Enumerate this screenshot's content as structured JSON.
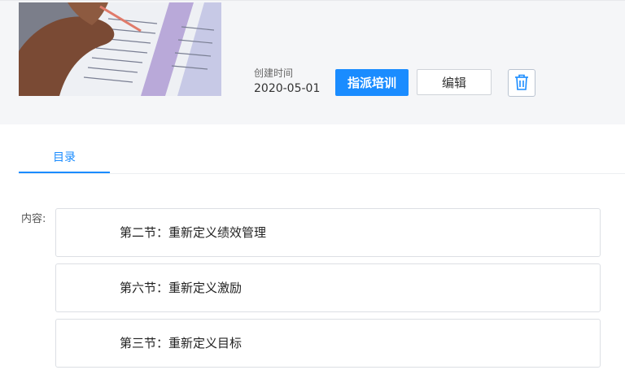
{
  "course": {
    "created_label": "创建时间",
    "created_date": "2020-05-01"
  },
  "actions": {
    "assign_label": "指派培训",
    "edit_label": "编辑",
    "delete_icon": "trash-icon"
  },
  "tabs": [
    {
      "label": "目录"
    }
  ],
  "content": {
    "label": "内容:",
    "items": [
      {
        "label": "第二节：重新定义绩效管理"
      },
      {
        "label": "第六节：重新定义激励"
      },
      {
        "label": "第三节：重新定义目标"
      }
    ]
  },
  "colors": {
    "primary": "#1a8cff",
    "header_bg": "#f5f6f8"
  }
}
